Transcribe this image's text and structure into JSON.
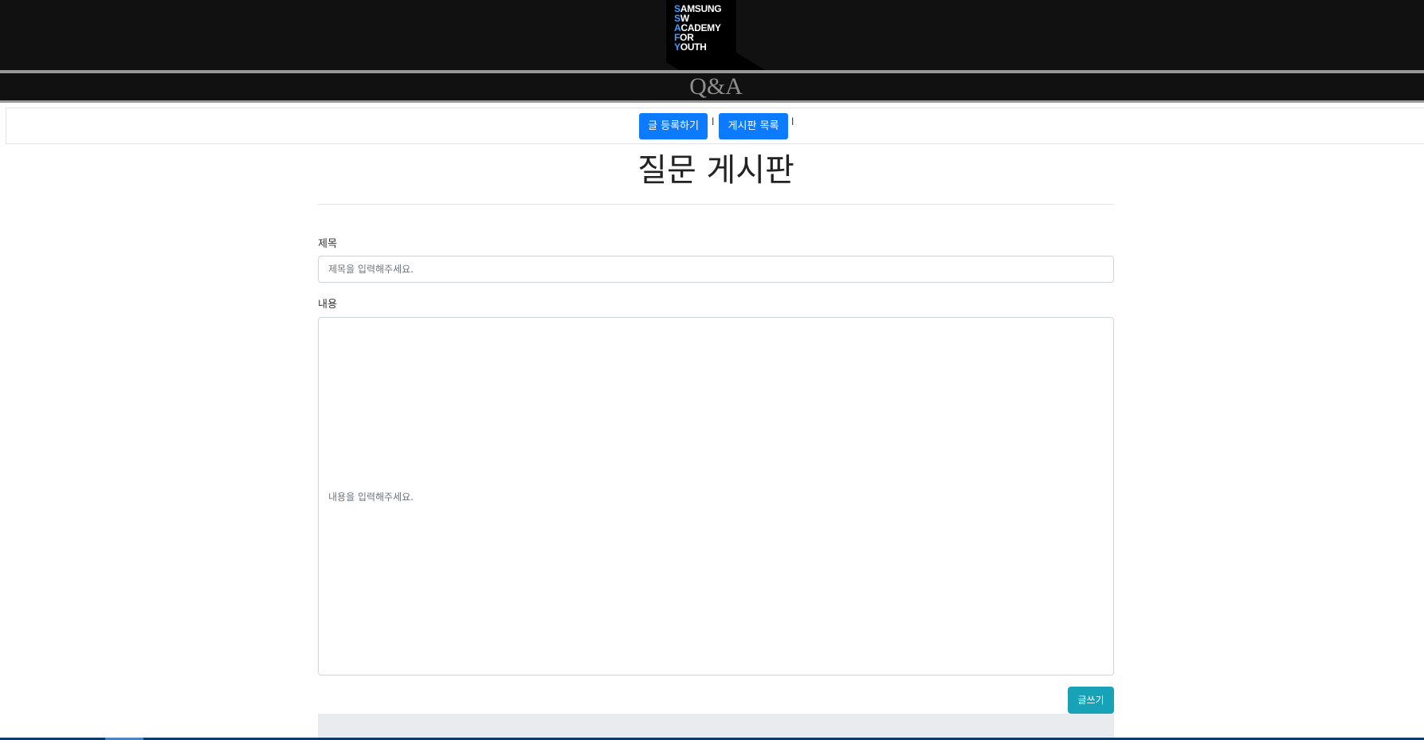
{
  "header": {
    "logo_lines": [
      {
        "initial": "S",
        "rest": "AMSUNG"
      },
      {
        "initial": "S",
        "rest": "W"
      },
      {
        "initial": "A",
        "rest": "CADEMY"
      },
      {
        "initial": "F",
        "rest": "OR"
      },
      {
        "initial": "Y",
        "rest": "OUTH"
      }
    ],
    "subtitle": "Q&A"
  },
  "nav": {
    "write_label": "글 등록하기",
    "separator": "l",
    "list_label": "게시판 목록"
  },
  "page": {
    "title": "질문 게시판"
  },
  "form": {
    "title_label": "제목",
    "title_placeholder": "제목을 입력해주세요.",
    "title_value": "",
    "content_label": "내용",
    "content_placeholder": "내용을 입력해주세요.",
    "submit_label": "글쓰기"
  },
  "colors": {
    "primary": "#0d7bff",
    "info": "#17a2b8",
    "header_bg": "#111111"
  }
}
